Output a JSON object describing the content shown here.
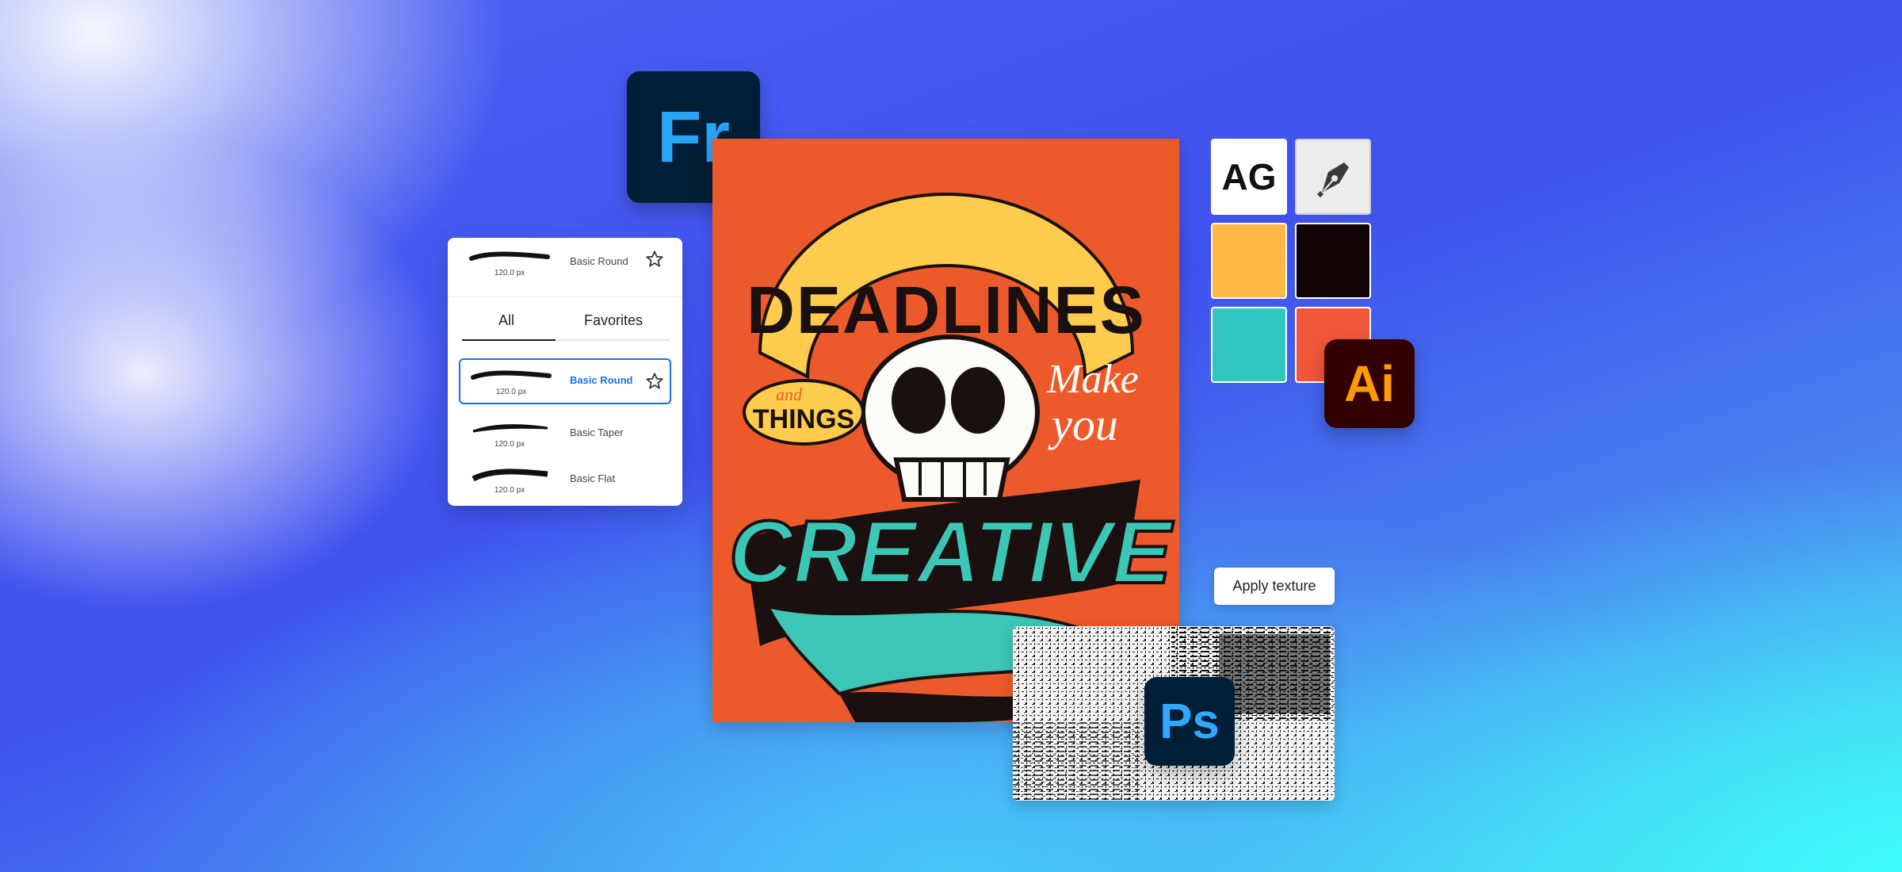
{
  "apps": {
    "fresco": {
      "label": "Fr",
      "bg": "#001e36",
      "fg": "#29a3f5"
    },
    "illustrator": {
      "label": "Ai",
      "bg": "#330000",
      "fg": "#ff9a00"
    },
    "photoshop": {
      "label": "Ps",
      "bg": "#001e36",
      "fg": "#31a8ff"
    }
  },
  "brush_panel": {
    "top_brush": {
      "size": "120.0 px",
      "name": "Basic Round"
    },
    "tabs": [
      "All",
      "Favorites"
    ],
    "brushes": [
      {
        "size": "120.0 px",
        "name": "Basic Round",
        "selected": true
      },
      {
        "size": "120.0 px",
        "name": "Basic Taper",
        "selected": false
      },
      {
        "size": "120.0 px",
        "name": "Basic Flat",
        "selected": false
      }
    ],
    "accent": "#1473e6",
    "star_icon": "star-outline-icon"
  },
  "poster": {
    "lines": [
      "DEADLINES",
      "and",
      "THINGS",
      "Make",
      "you",
      "CREATIVE"
    ],
    "colors": {
      "background": "#ec5a2b",
      "yellow": "#ffcc4d",
      "teal": "#3cc6b6",
      "black": "#1a1010"
    }
  },
  "tools": {
    "font_tile": "AG",
    "pen_icon": "pen-tool-icon",
    "swatches": [
      "#ffb844",
      "#120304",
      "#30c7c0",
      "#f2573b"
    ]
  },
  "texture": {
    "button_label": "Apply texture"
  }
}
